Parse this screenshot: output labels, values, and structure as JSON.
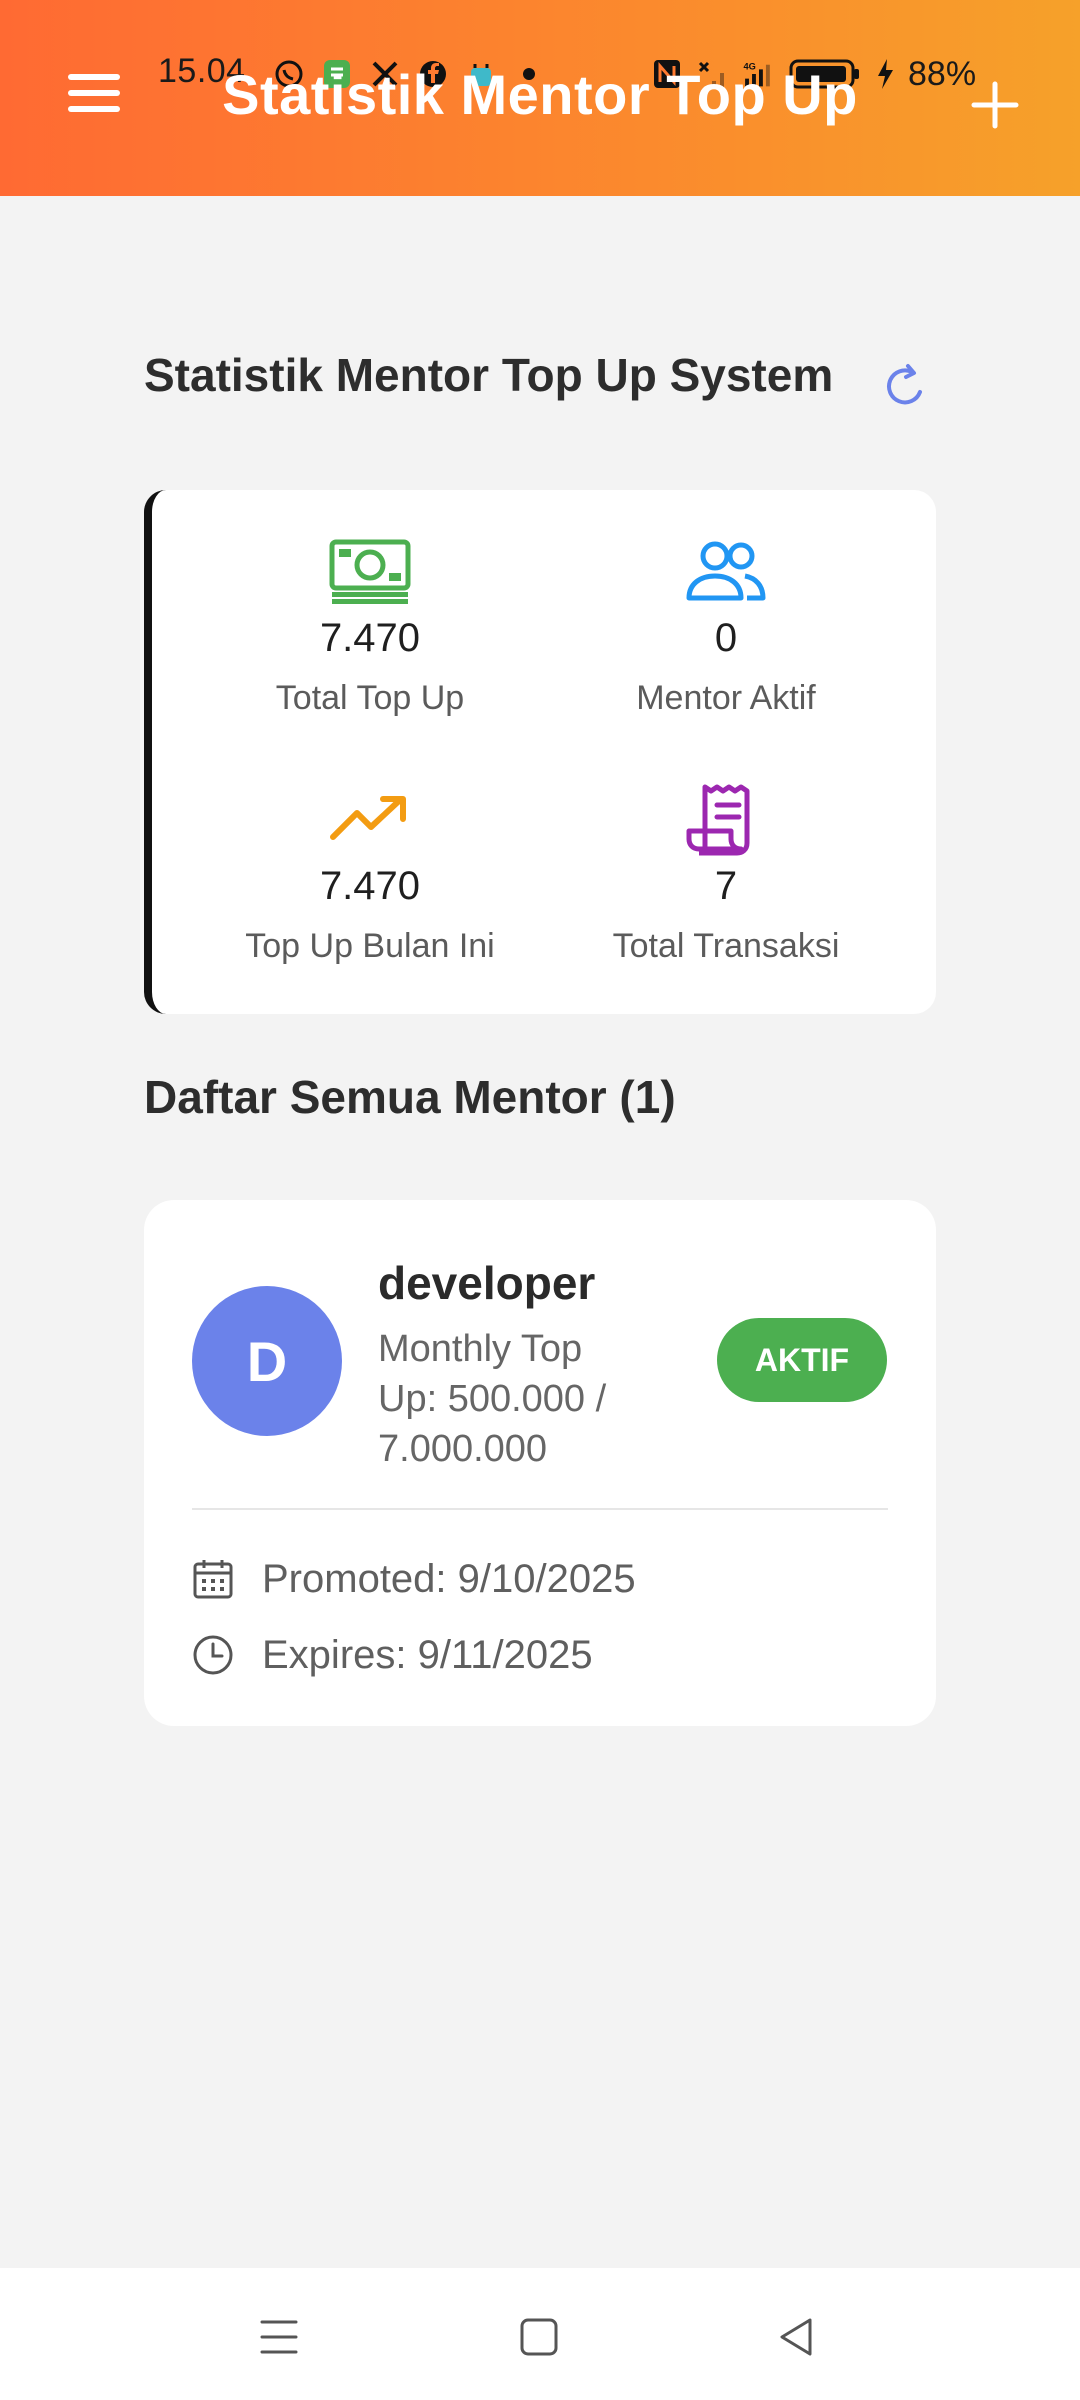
{
  "status_bar": {
    "time": "15.04",
    "battery": "88%",
    "network": "4G"
  },
  "header": {
    "title": "Statistik Mentor Top Up",
    "color_start": "#ff6a33",
    "color_end": "#f6a12a"
  },
  "stats_section": {
    "title": "Statistik Mentor Top Up System",
    "refresh_icon": "refresh-icon",
    "items": [
      {
        "icon": "money-icon",
        "value": "7.470",
        "label": "Total Top Up",
        "color": "#4caf50"
      },
      {
        "icon": "users-icon",
        "value": "0",
        "label": "Mentor Aktif",
        "color": "#2196f3"
      },
      {
        "icon": "trending-up-icon",
        "value": "7.470",
        "label": "Top Up Bulan Ini",
        "color": "#f39c12"
      },
      {
        "icon": "receipt-icon",
        "value": "7",
        "label": "Total Transaksi",
        "color": "#9c27b0"
      }
    ]
  },
  "mentor_list": {
    "title": "Daftar Semua Mentor (1)",
    "mentors": [
      {
        "initial": "D",
        "name": "developer",
        "monthly_topup": "Monthly Top Up: 500.000 / 7.000.000",
        "status": "AKTIF",
        "promoted": "Promoted: 9/10/2025",
        "expires": "Expires: 9/11/2025",
        "avatar_color": "#6b82ea",
        "status_color": "#4caf50"
      }
    ]
  },
  "bottom_nav": {
    "items": [
      "recent-apps-icon",
      "home-icon",
      "back-icon"
    ]
  }
}
